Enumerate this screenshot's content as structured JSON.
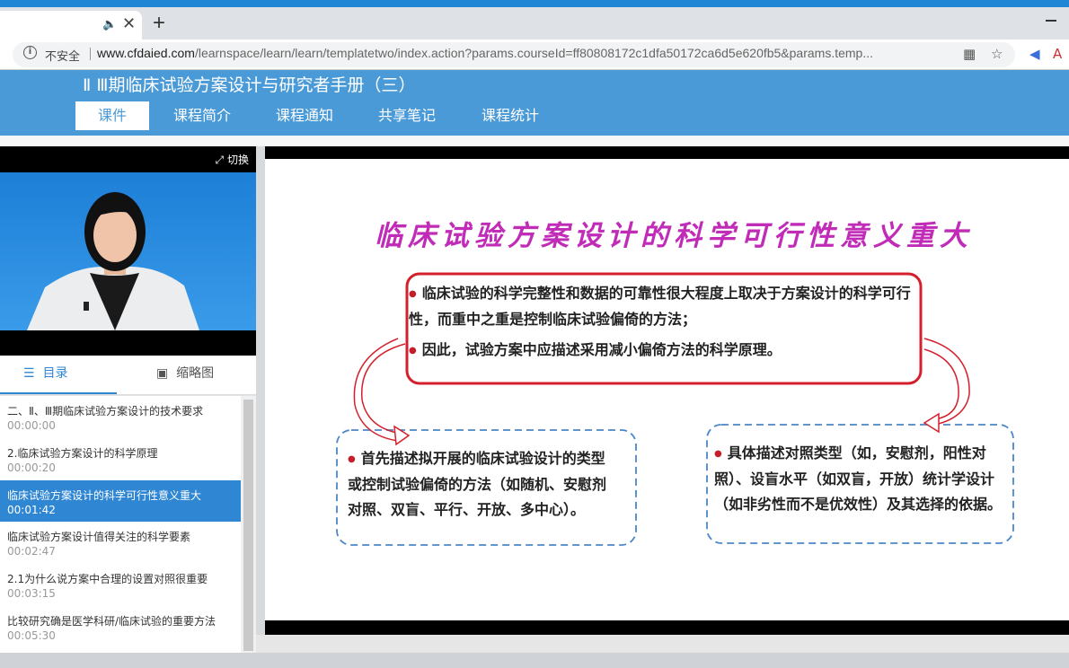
{
  "browser": {
    "tab_audio_icon": "speaker-icon",
    "insecure_label": "不安全",
    "url_host": "www.cfdaied.com",
    "url_path": "/learnspace/learn/learn/templatetwo/index.action?params.courseId=ff80808172c1dfa50172ca6d5e620fb5&params.temp..."
  },
  "header": {
    "course_title": "Ⅱ Ⅲ期临床试验方案设计与研究者手册（三）",
    "nav": [
      {
        "label": "课件"
      },
      {
        "label": "课程简介"
      },
      {
        "label": "课程通知"
      },
      {
        "label": "共享笔记"
      },
      {
        "label": "课程统计"
      }
    ]
  },
  "player": {
    "switch_label": "切换"
  },
  "side_tabs": {
    "catalog": "目录",
    "thumbnail": "缩略图"
  },
  "catalog": [
    {
      "name": "二、Ⅱ、Ⅲ期临床试验方案设计的技术要求",
      "time": "00:00:00"
    },
    {
      "name": "2.临床试验方案设计的科学原理",
      "time": "00:00:20"
    },
    {
      "name": "临床试验方案设计的科学可行性意义重大",
      "time": "00:01:42"
    },
    {
      "name": "临床试验方案设计值得关注的科学要素",
      "time": "00:02:47"
    },
    {
      "name": "2.1为什么说方案中合理的设置对照很重要",
      "time": "00:03:15"
    },
    {
      "name": "比较研究确是医学科研/临床试验的重要方法",
      "time": "00:05:30"
    }
  ],
  "slide": {
    "title": "临床试验方案设计的科学可行性意义重大",
    "top_box": [
      "临床试验的科学完整性和数据的可靠性很大程度上取决于方案设计的科学可行性，而重中之重是控制临床试验偏倚的方法；",
      "因此，试验方案中应描述采用减小偏倚方法的科学原理。"
    ],
    "left_box": "首先描述拟开展的临床试验设计的类型或控制试验偏倚的方法（如随机、安慰剂对照、双盲、平行、开放、多中心）。",
    "right_box": "具体描述对照类型（如，安慰剂，阳性对照）、设盲水平（如双盲，开放）统计学设计（如非劣性而不是优效性）及其选择的依据。"
  }
}
